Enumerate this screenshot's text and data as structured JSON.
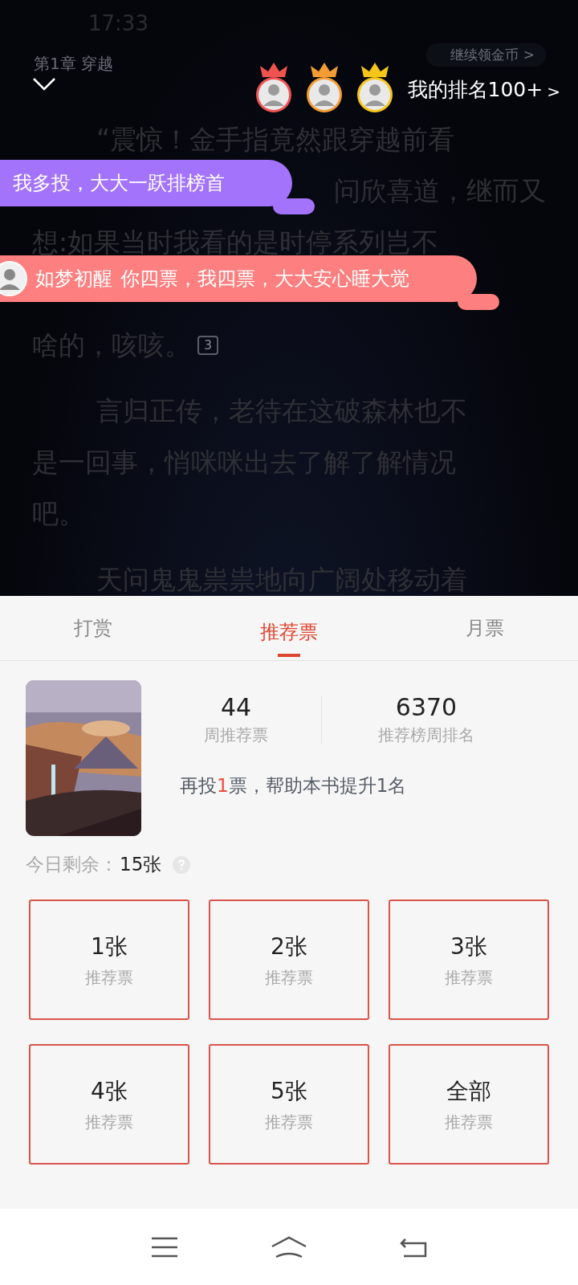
{
  "status_bar": {
    "time": "17:33"
  },
  "header": {
    "chapter": "第1章 穿越",
    "coin_hint": "继续领金币 >",
    "ranking": "我的排名100+",
    "ranking_arrow": ">",
    "top_fans": [
      {
        "color": "#ef5350"
      },
      {
        "color": "#f39c34"
      },
      {
        "color": "#f5c518"
      }
    ]
  },
  "reading": {
    "paragraphs": [
      {
        "lines": [
          {
            "text": "“震惊！金手指竟然跟穿越前看"
          },
          {
            "text": "问欣喜道，继而又"
          },
          {
            "text": "想:如果当时我看的是时停系列岂不"
          },
          {
            "text": "啥的，咳咳。",
            "comment_count": "3"
          }
        ]
      },
      {
        "lines": [
          {
            "text": "言归正传，老待在这破森林也不"
          },
          {
            "text": "是一回事，悄咪咪出去了解了解情况"
          },
          {
            "text": "吧。"
          }
        ]
      },
      {
        "lines": [
          {
            "text": "天问鬼鬼祟祟地向广阔处移动着"
          }
        ]
      }
    ]
  },
  "danmaku": [
    {
      "text": "我多投，大大一跃排榜首",
      "color": "#a374fb",
      "avatar": false
    },
    {
      "user": "如梦初醒",
      "text": "你四票，我四票，大大安心睡大觉",
      "color": "#fe7f7f",
      "avatar": true
    }
  ],
  "panel": {
    "tabs": [
      {
        "label": "打赏",
        "selected": false
      },
      {
        "label": "推荐票",
        "selected": true
      },
      {
        "label": "月票",
        "selected": false
      }
    ],
    "book": {
      "stats": [
        {
          "value": "44",
          "label": "周推荐票"
        },
        {
          "value": "6370",
          "label": "推荐榜周排名"
        }
      ],
      "hint": {
        "before": "再投",
        "highlight": "1",
        "after": "票，帮助本书提升1名"
      }
    },
    "remaining": {
      "label": "今日剩余：",
      "value": "15张"
    },
    "options": [
      {
        "amount": "1张",
        "label": "推荐票"
      },
      {
        "amount": "2张",
        "label": "推荐票"
      },
      {
        "amount": "3张",
        "label": "推荐票"
      },
      {
        "amount": "4张",
        "label": "推荐票"
      },
      {
        "amount": "5张",
        "label": "推荐票"
      },
      {
        "amount": "全部",
        "label": "推荐票"
      }
    ]
  }
}
